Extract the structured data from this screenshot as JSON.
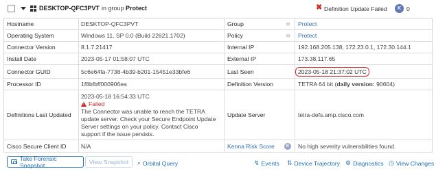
{
  "header": {
    "hostname": "DESKTOP-QFC3PVT",
    "group_prefix": "in group",
    "group_name": "Protect",
    "status_text": "Definition Update Failed",
    "kenna_badge": "K",
    "kenna_count": "0"
  },
  "rows": {
    "hostname": {
      "label": "Hostname",
      "value": "DESKTOP-QFC3PVT"
    },
    "group": {
      "label": "Group",
      "value": "Protect"
    },
    "os": {
      "label": "Operating System",
      "value": "Windows 11, SP 0.0 (Build 22621.1702)"
    },
    "policy": {
      "label": "Policy",
      "value": "Protect"
    },
    "connector_version": {
      "label": "Connector Version",
      "value": "8.1.7.21417"
    },
    "internal_ip": {
      "label": "Internal IP",
      "value": "192.168.205.138, 172.23.0.1, 172.30.144.1"
    },
    "install_date": {
      "label": "Install Date",
      "value": "2023-05-17 01:58:07 UTC"
    },
    "external_ip": {
      "label": "External IP",
      "value": "173.38.117.65"
    },
    "connector_guid": {
      "label": "Connector GUID",
      "value": "5c6e64fa-7738-4b39-b201-15451e33bfe6"
    },
    "last_seen": {
      "label": "Last Seen",
      "value": "2023-05-18 21:37:02 UTC"
    },
    "processor_id": {
      "label": "Processor ID",
      "value": "1f8bfbff000906ea"
    },
    "definition_version": {
      "label": "Definition Version",
      "value": "TETRA 64 bit",
      "daily_prefix": "daily version:",
      "daily_value": "90604"
    },
    "definitions_last_updated": {
      "label": "Definitions Last Updated",
      "timestamp": "2023-05-18 16:54:33 UTC",
      "status": "Failed",
      "message_lines": [
        "The Connector was unable to reach the TETRA",
        "update server. Check your Secure Endpoint Update",
        "Server settings on your policy. Contact Cisco",
        "support if the issue persists."
      ]
    },
    "update_server": {
      "label": "Update Server",
      "value": "tetra-defs.amp.cisco.com"
    },
    "client_id": {
      "label": "Cisco Secure Client ID",
      "value": "N/A"
    },
    "kenna_risk": {
      "label": "Kenna Risk Score",
      "badge": "K",
      "value": "No high severity vulnerabilities found."
    }
  },
  "footer": {
    "forensic_button": "Take Forensic Snapshot",
    "view_snapshot_button": "View Snapshot",
    "orbital_query": "Orbital Query",
    "events": "Events",
    "device_trajectory": "Device Trajectory",
    "diagnostics": "Diagnostics",
    "view_changes": "View Changes"
  },
  "colors": {
    "link": "#2f6fb2",
    "error": "#cf2c2c",
    "highlight_ring": "#d12a2a",
    "kenna_badge": "#5e78b4"
  }
}
